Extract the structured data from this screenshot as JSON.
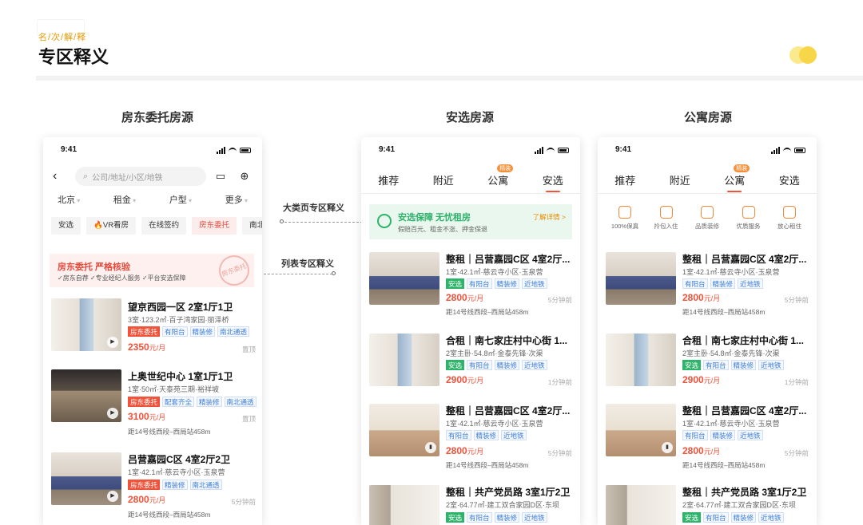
{
  "header": {
    "tag": "名/次/解/释",
    "title": "专区释义"
  },
  "brand_colors": {
    "accent": "#f0523a",
    "green": "#2db36a",
    "blue": "#3d7ed8",
    "logo_yellow": "#f7d64a"
  },
  "columns": {
    "landlord": "房东委托房源",
    "selected": "安选房源",
    "apartment": "公寓房源"
  },
  "connectors": {
    "category": "大类页专区释义",
    "list": "列表专区释义"
  },
  "phone": {
    "time": "9:41"
  },
  "landlord_phone": {
    "search_placeholder": "公司/地址/小区/地铁",
    "filters": [
      "北京",
      "租金",
      "户型",
      "更多"
    ],
    "chips": [
      "安选",
      "VR看房",
      "在线签约",
      "房东委托",
      "南北"
    ],
    "banner": {
      "title": "房东委托 严格核验",
      "sub": "✓房东自荐 ✓专业经纪人服务 ✓平台安选保障",
      "stamp": "房东委托"
    },
    "listings": [
      {
        "title": "望京西园一区 2室1厅1卫",
        "sub": "3室·123.2㎡·百子湾家园·丽泽桥",
        "tags": [
          "房东委托",
          "有阳台",
          "精装修",
          "南北通透"
        ],
        "price": "2350",
        "unit": "元/月",
        "time": "置顶",
        "metro": ""
      },
      {
        "title": "上奥世纪中心 1室1厅1卫",
        "sub": "1室·50㎡·天泰苑三期·裕祥坡",
        "tags": [
          "房东委托",
          "配套齐全",
          "精装修",
          "南北通透"
        ],
        "price": "3100",
        "unit": "元/月",
        "time": "置顶",
        "metro": "距14号线西段–西局站458m"
      },
      {
        "title": "吕营嘉园C区 4室2厅2卫",
        "sub": "1室·42.1㎡·慈云寺小区·玉泉营",
        "tags": [
          "房东委托",
          "精装修",
          "南北通透"
        ],
        "price": "2800",
        "unit": "元/月",
        "time": "5分钟前",
        "metro": "距14号线西段–西局站458m"
      }
    ]
  },
  "tabs": [
    "推荐",
    "附近",
    "公寓",
    "安选"
  ],
  "tab_badge": "精装",
  "guarantee": {
    "title": "安选保障 无忧租房",
    "sub": "假赔百元、租金不涨、押金保退",
    "more": "了解详情 >"
  },
  "features": [
    "100%保真",
    "拎包入住",
    "品质装修",
    "优质服务",
    "放心租住"
  ],
  "list_listings": [
    {
      "title": "整租｜吕营嘉园C区 4室2厅...",
      "sub": "1室·42.1㎡·慈云寺小区·玉泉营",
      "tags": [
        "安选",
        "有阳台",
        "精装修",
        "近地铁"
      ],
      "price": "2800",
      "unit": "元/月",
      "time": "5分钟前",
      "metro": "距14号线西段–西局站458m"
    },
    {
      "title": "合租｜南七家庄村中心街 1...",
      "sub": "2室主卧·54.8㎡·金泰先锋·次渠",
      "tags": [
        "安选",
        "有阳台",
        "精装修",
        "近地铁"
      ],
      "price": "2900",
      "unit": "元/月",
      "time": "1分钟前",
      "metro": ""
    },
    {
      "title": "整租｜吕营嘉园C区 4室2厅...",
      "sub": "1室·42.1㎡·慈云寺小区·玉泉营",
      "tags": [
        "有阳台",
        "精装修",
        "近地铁"
      ],
      "price": "2800",
      "unit": "元/月",
      "time": "5分钟前",
      "metro": "距14号线西段–西局站458m"
    },
    {
      "title": "整租｜共产党员路 3室1厅2卫",
      "sub": "2室·64.77㎡·建工双合家园D区·东坝",
      "tags": [
        "安选",
        "有阳台",
        "精装修",
        "近地铁"
      ],
      "price": "",
      "unit": "",
      "time": "",
      "metro": ""
    }
  ]
}
